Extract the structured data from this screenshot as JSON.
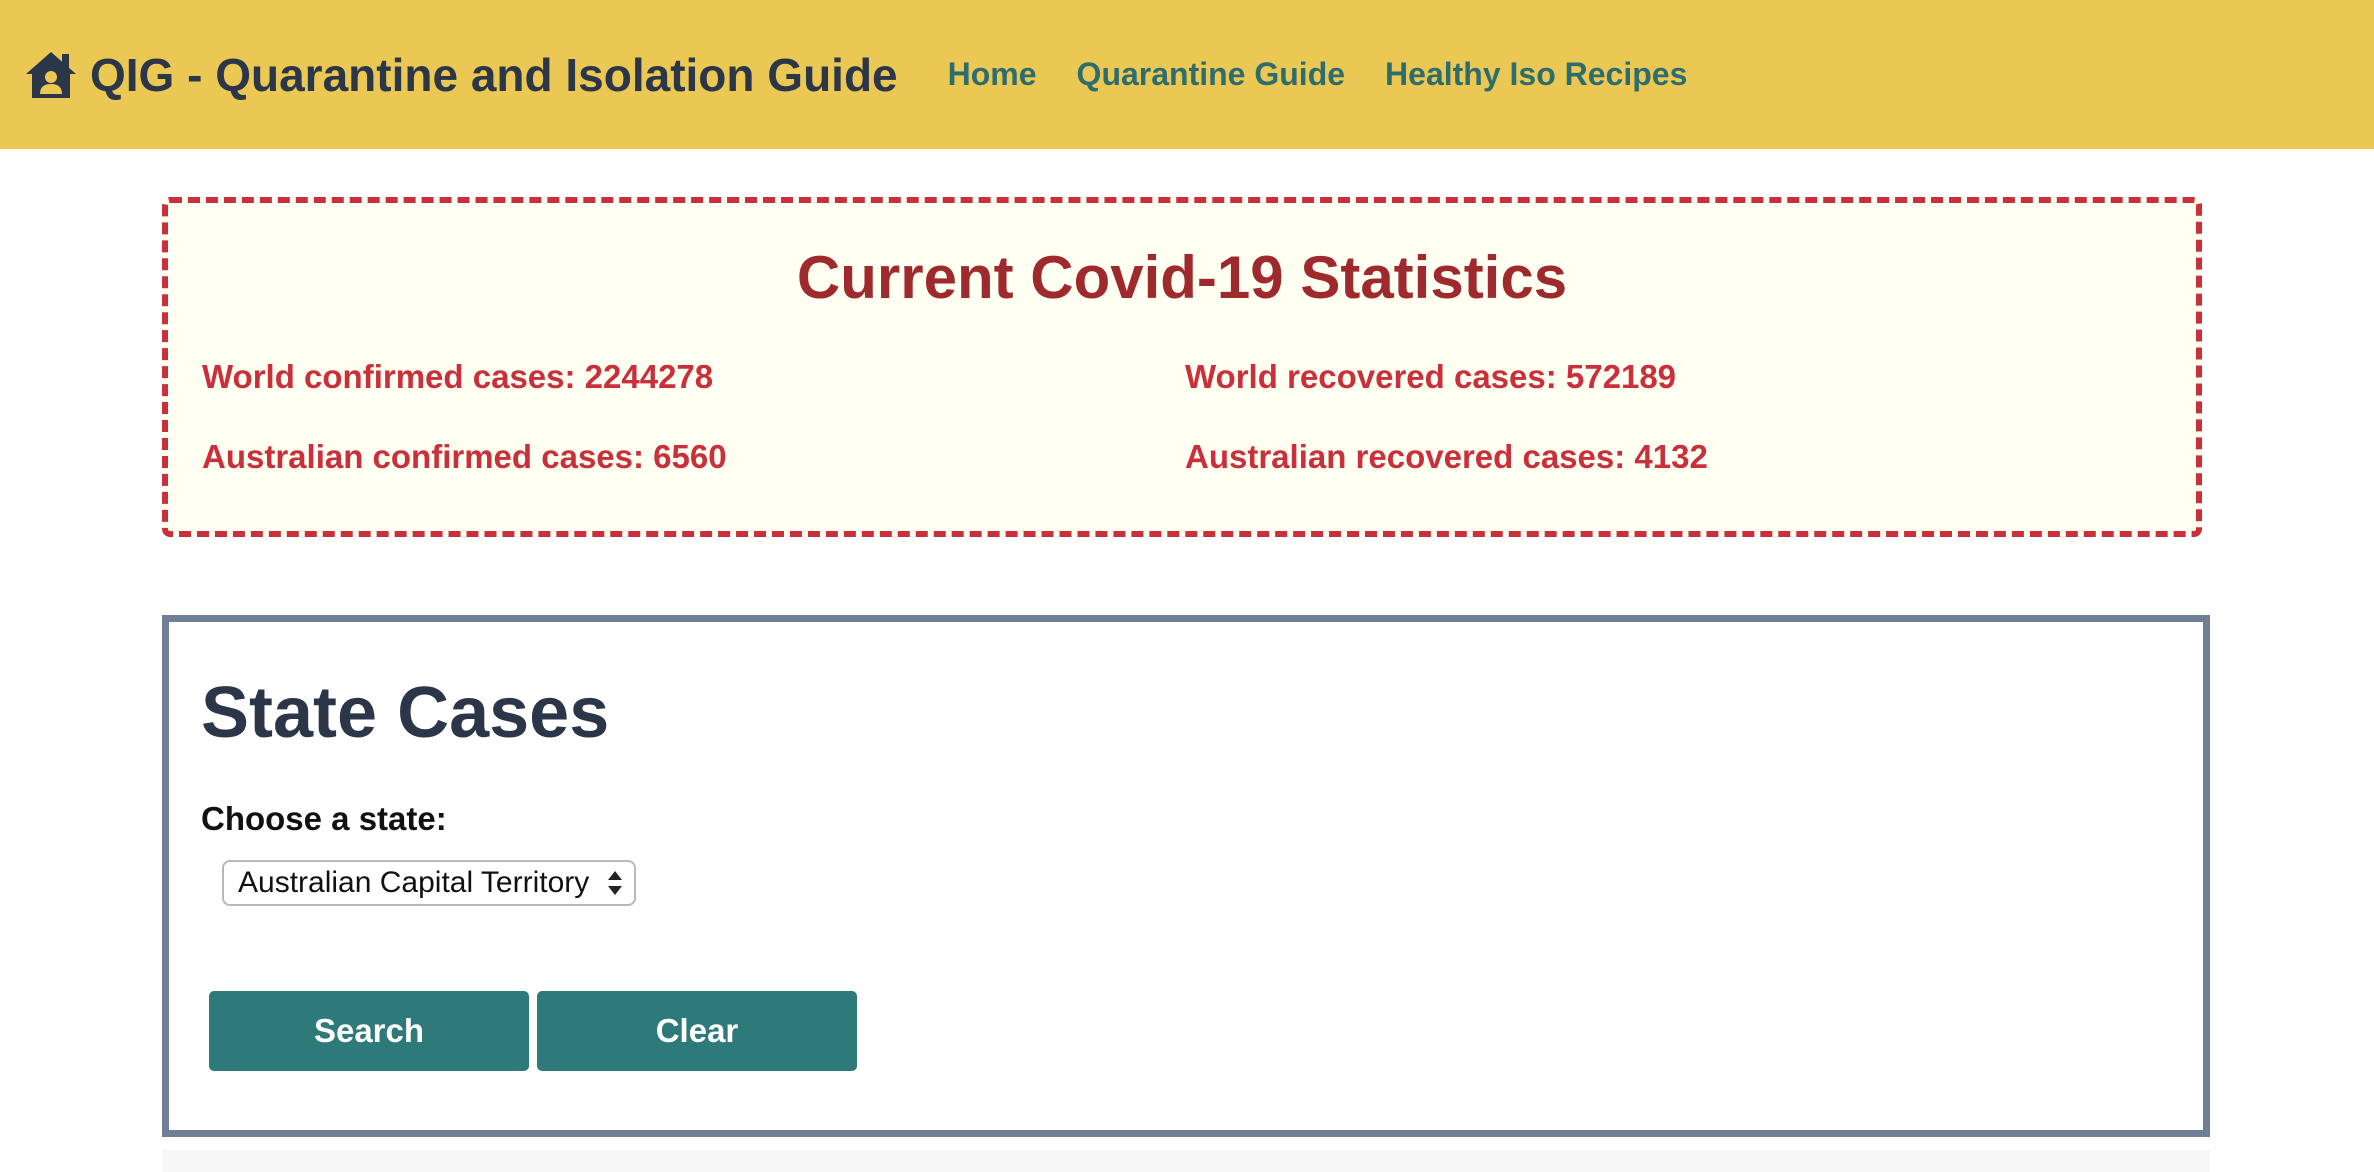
{
  "header": {
    "brand": "QIG - Quarantine and Isolation Guide",
    "brand_icon": "house-user-icon",
    "nav": [
      {
        "label": "Home"
      },
      {
        "label": "Quarantine Guide"
      },
      {
        "label": "Healthy Iso Recipes"
      }
    ]
  },
  "stats": {
    "title": "Current Covid-19 Statistics",
    "world_confirmed": "World confirmed cases: 2244278",
    "world_recovered": "World recovered cases: 572189",
    "aus_confirmed": "Australian confirmed cases: 6560",
    "aus_recovered": "Australian recovered cases: 4132"
  },
  "state_cases": {
    "title": "State Cases",
    "label": "Choose a state:",
    "selected": "Australian Capital Territory",
    "search_label": "Search",
    "clear_label": "Clear"
  },
  "colors": {
    "header_bg": "#ebc853",
    "accent": "#2e7a7a",
    "alert": "#c9303b"
  }
}
